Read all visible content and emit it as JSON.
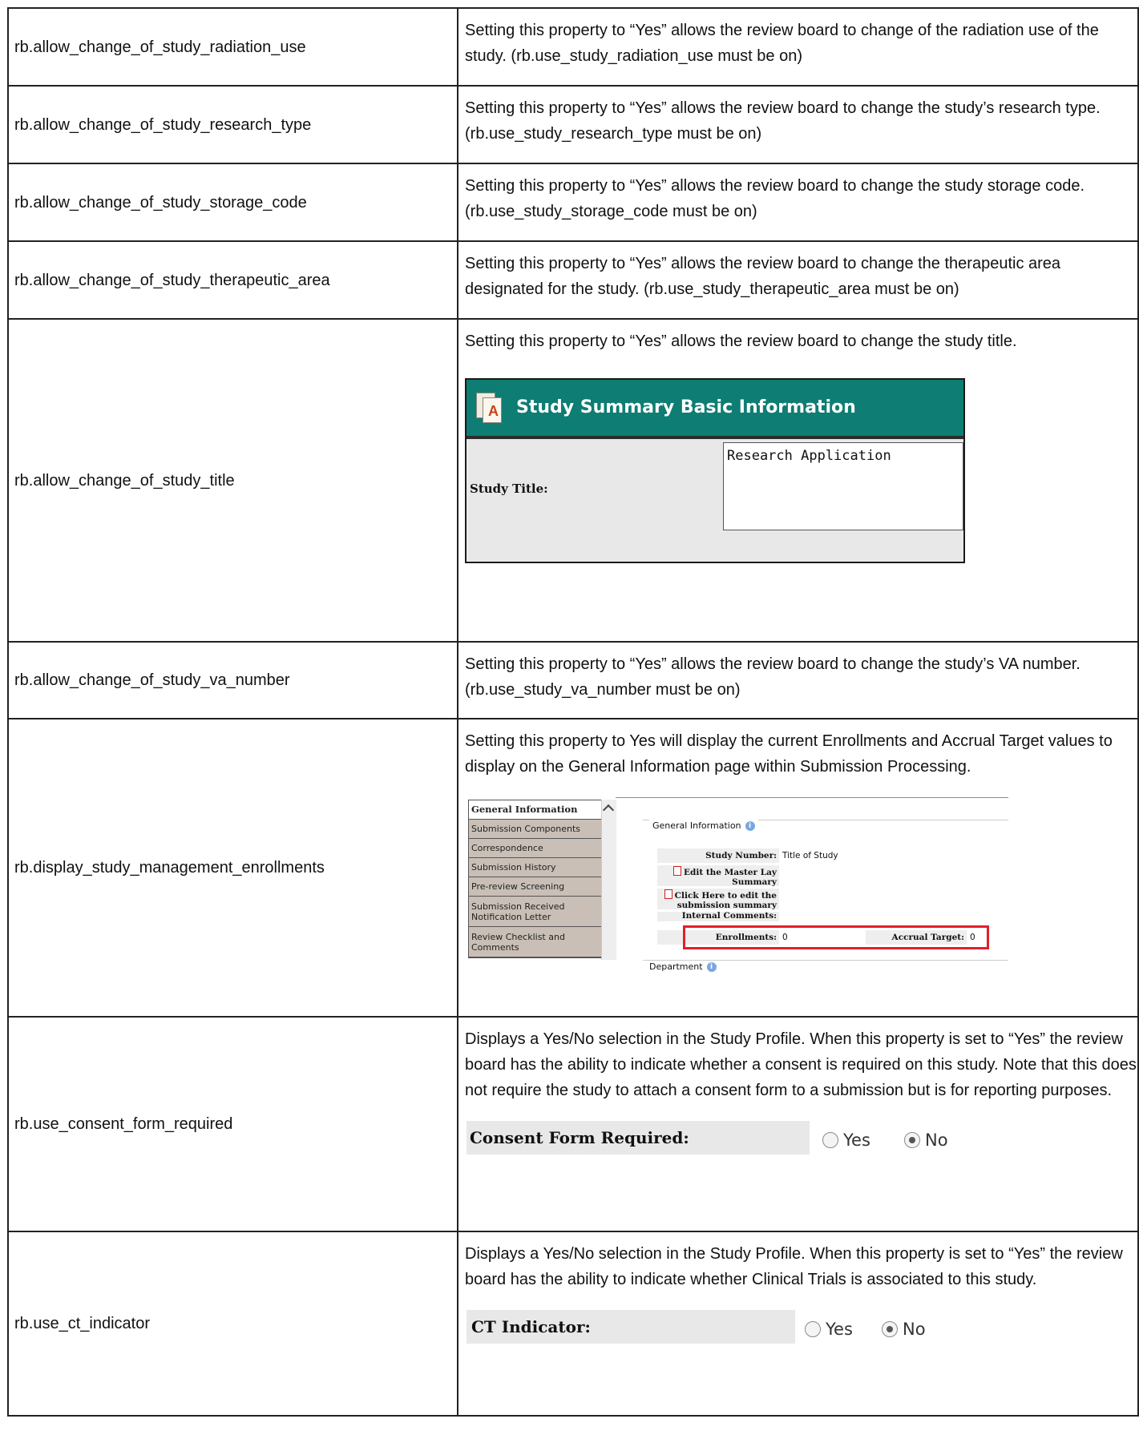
{
  "rows": [
    {
      "property": "rb.allow_change_of_study_radiation_use",
      "description": "Setting this property to “Yes” allows the review board to change of the radiation use of the study.  (rb.use_study_radiation_use must be on)"
    },
    {
      "property": "rb.allow_change_of_study_research_type",
      "description": "Setting this property to “Yes” allows the review board to change the study’s research type.  (rb.use_study_research_type must be on)"
    },
    {
      "property": "rb.allow_change_of_study_storage_code",
      "description": "Setting this property to “Yes” allows the review board to change the study storage code.  (rb.use_study_storage_code must be on)"
    },
    {
      "property": "rb.allow_change_of_study_therapeutic_area",
      "description": "Setting this property to “Yes” allows the review board to change the therapeutic area designated for the study.  (rb.use_study_therapeutic_area must be on)"
    },
    {
      "property": "rb.allow_change_of_study_title",
      "description": "Setting this property to “Yes” allows the review board to change the study title."
    },
    {
      "property": "rb.allow_change_of_study_va_number",
      "description": "Setting this property to “Yes” allows the review board to change the study’s VA number.  (rb.use_study_va_number must be on)"
    },
    {
      "property": "rb.display_study_management_enrollments",
      "description": "Setting this property to Yes will display the current Enrollments and Accrual Target values to display on the General Information page within Submission Processing."
    },
    {
      "property": "rb.use_consent_form_required",
      "description": "Displays a Yes/No selection in the Study Profile. When this property is set to “Yes” the review board has the ability to indicate whether a consent is required on this study. Note that this does not require the study to attach a consent form to a submission but is for reporting purposes."
    },
    {
      "property": "rb.use_ct_indicator",
      "description": "Displays a Yes/No selection in the Study Profile. When this property is set to “Yes” the review board has the ability to indicate whether Clinical Trials is associated to this study."
    }
  ],
  "study_summary": {
    "title": "Study Summary Basic Information",
    "field_label": "Study Title:",
    "field_value": "Research Application"
  },
  "general_info": {
    "nav": [
      "General Information",
      "Submission Components",
      "Correspondence",
      "Submission History",
      "Pre-review Screening",
      "Submission Received Notification Letter",
      "Review Checklist and Comments"
    ],
    "legend": "General Information",
    "study_number_label": "Study Number:",
    "study_number_value": "Title of Study",
    "edit_master_lay": "Edit the Master Lay Summary",
    "click_here_edit": "Click Here to edit the submission summary",
    "internal_comments": "Internal Comments:",
    "enrollments_label": "Enrollments:",
    "enrollments_value": "0",
    "accrual_label": "Accrual Target:",
    "accrual_value": "0",
    "department_legend": "Department",
    "highlight_color": "#e0202a"
  },
  "consent": {
    "label": "Consent Form Required:",
    "yes": "Yes",
    "no": "No",
    "selected": "No"
  },
  "ct": {
    "label": "CT Indicator:",
    "yes": "Yes",
    "no": "No",
    "selected": "No"
  }
}
